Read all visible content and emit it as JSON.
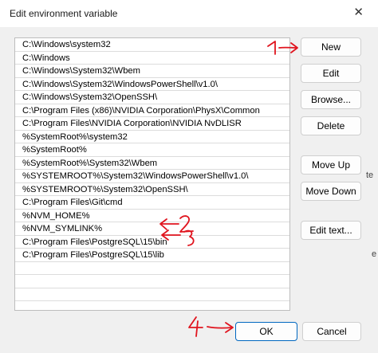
{
  "dialog": {
    "title": "Edit environment variable",
    "close_glyph": "✕"
  },
  "paths": [
    "C:\\Windows\\system32",
    "C:\\Windows",
    "C:\\Windows\\System32\\Wbem",
    "C:\\Windows\\System32\\WindowsPowerShell\\v1.0\\",
    "C:\\Windows\\System32\\OpenSSH\\",
    "C:\\Program Files (x86)\\NVIDIA Corporation\\PhysX\\Common",
    "C:\\Program Files\\NVIDIA Corporation\\NVIDIA NvDLISR",
    "%SystemRoot%\\system32",
    "%SystemRoot%",
    "%SystemRoot%\\System32\\Wbem",
    "%SYSTEMROOT%\\System32\\WindowsPowerShell\\v1.0\\",
    "%SYSTEMROOT%\\System32\\OpenSSH\\",
    "C:\\Program Files\\Git\\cmd",
    "%NVM_HOME%",
    "%NVM_SYMLINK%",
    "C:\\Program Files\\PostgreSQL\\15\\bin",
    "C:\\Program Files\\PostgreSQL\\15\\lib"
  ],
  "buttons": {
    "new": "New",
    "edit": "Edit",
    "browse": "Browse...",
    "delete": "Delete",
    "move_up": "Move Up",
    "move_down": "Move Down",
    "edit_text": "Edit text...",
    "ok": "OK",
    "cancel": "Cancel"
  },
  "annotations": {
    "color": "#e0141e",
    "labels": [
      "1",
      "2",
      "3",
      "4"
    ]
  },
  "background_fragments": [
    "te",
    "e"
  ]
}
